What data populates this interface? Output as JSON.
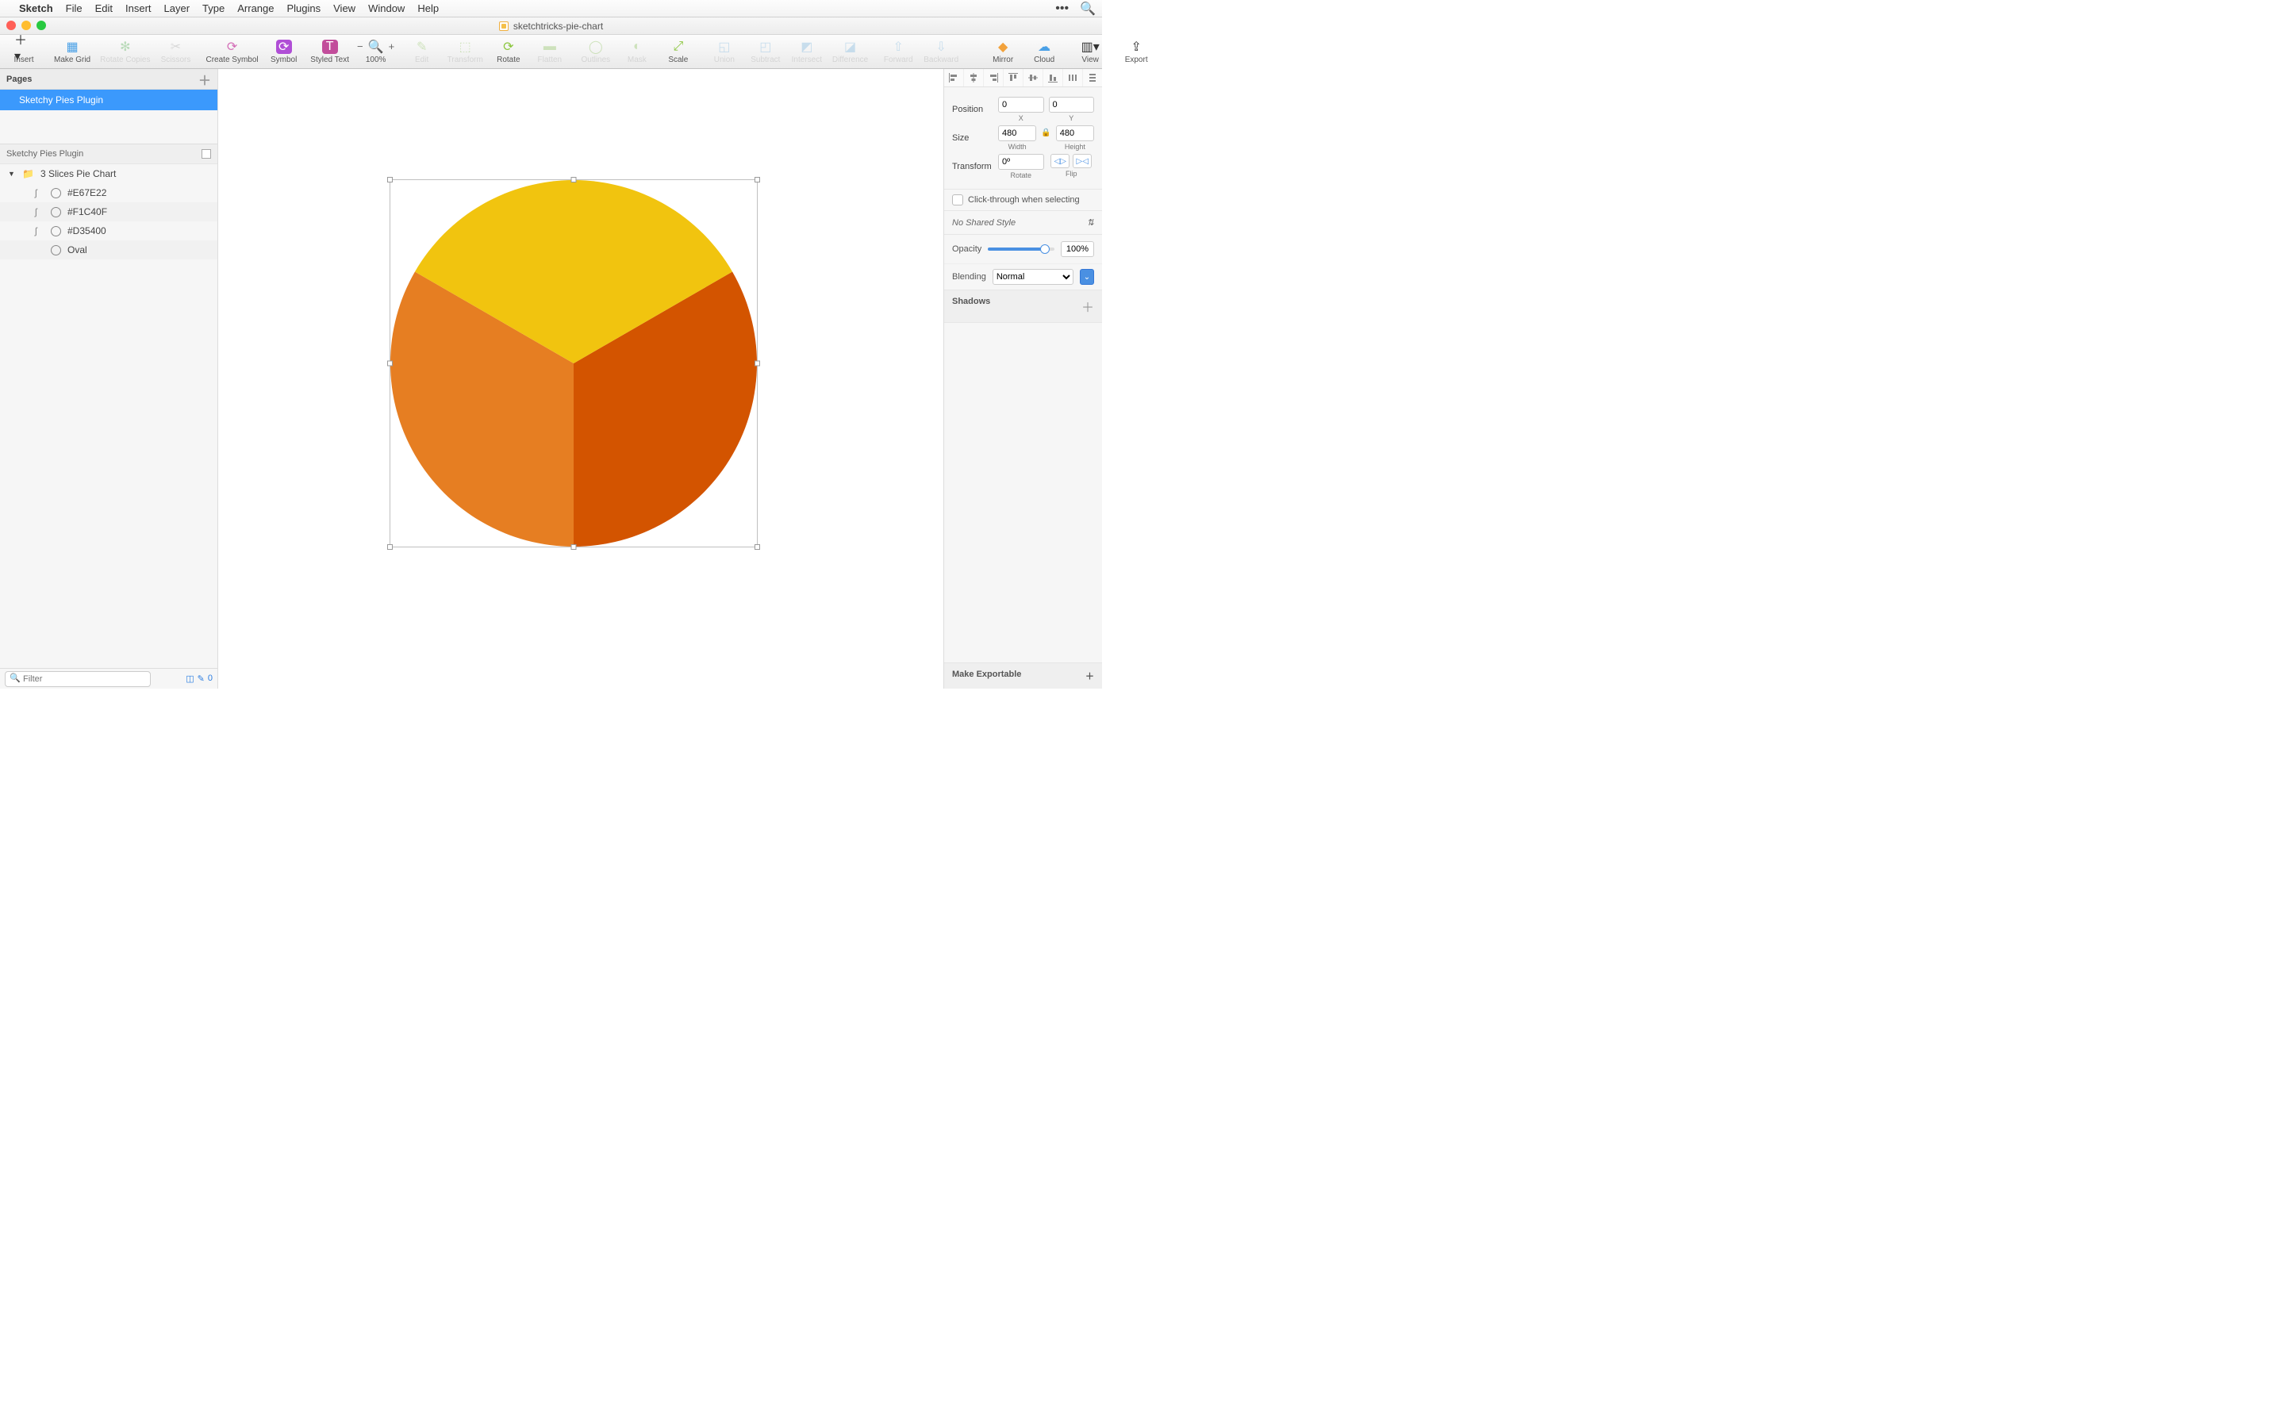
{
  "menubar": {
    "items": [
      "Sketch",
      "File",
      "Edit",
      "Insert",
      "Layer",
      "Type",
      "Arrange",
      "Plugins",
      "View",
      "Window",
      "Help"
    ]
  },
  "window": {
    "title": "sketchtricks-pie-chart"
  },
  "toolbar": {
    "insert": "Insert",
    "make_grid": "Make Grid",
    "rotate_copies": "Rotate Copies",
    "scissors": "Scissors",
    "create_symbol": "Create Symbol",
    "symbol": "Symbol",
    "styled_text": "Styled Text",
    "zoom_level": "100%",
    "edit": "Edit",
    "transform": "Transform",
    "rotate": "Rotate",
    "flatten": "Flatten",
    "outlines": "Outlines",
    "mask": "Mask",
    "scale": "Scale",
    "union": "Union",
    "subtract": "Subtract",
    "intersect": "Intersect",
    "difference": "Difference",
    "forward": "Forward",
    "backward": "Backward",
    "mirror": "Mirror",
    "cloud": "Cloud",
    "view": "View",
    "export": "Export"
  },
  "left": {
    "pages_header": "Pages",
    "page_name": "Sketchy Pies Plugin",
    "layers_header": "Sketchy Pies Plugin",
    "layers": [
      {
        "name": "3 Slices Pie Chart",
        "type": "folder",
        "selected": true
      },
      {
        "name": "#E67E22",
        "type": "shape"
      },
      {
        "name": "#F1C40F",
        "type": "shape"
      },
      {
        "name": "#D35400",
        "type": "shape"
      },
      {
        "name": "Oval",
        "type": "oval"
      }
    ],
    "filter_placeholder": "Filter",
    "filter_badge_count": "0"
  },
  "inspector": {
    "position_label": "Position",
    "pos_x": "0",
    "pos_x_sub": "X",
    "pos_y": "0",
    "pos_y_sub": "Y",
    "size_label": "Size",
    "width": "480",
    "width_sub": "Width",
    "height": "480",
    "height_sub": "Height",
    "transform_label": "Transform",
    "rotate": "0º",
    "rotate_sub": "Rotate",
    "flip_sub": "Flip",
    "clickthrough": "Click-through when selecting",
    "shared_style": "No Shared Style",
    "opacity_label": "Opacity",
    "opacity_val": "100%",
    "blending_label": "Blending",
    "blending_val": "Normal",
    "shadows_label": "Shadows",
    "make_exportable": "Make Exportable"
  },
  "chart_data": {
    "type": "pie",
    "slices": [
      {
        "name": "#F1C40F",
        "value": 33.33,
        "color": "#F1C40F"
      },
      {
        "name": "#D35400",
        "value": 33.33,
        "color": "#D35400"
      },
      {
        "name": "#E67E22",
        "value": 33.33,
        "color": "#E67E22"
      }
    ]
  }
}
